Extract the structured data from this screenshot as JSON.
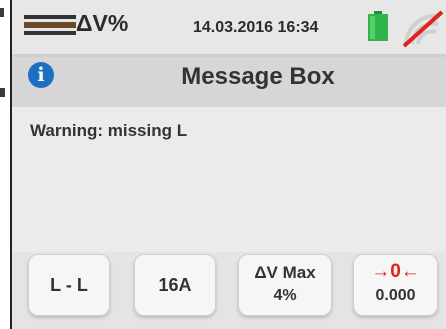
{
  "status_bar": {
    "mode_label": "ΔV%",
    "datetime": "14.03.2016  16:34",
    "battery_icon": "battery-icon",
    "signal_icon": "no-signal-icon"
  },
  "title_bar": {
    "icon": "info-icon",
    "title": "Message Box"
  },
  "message": "Warning: missing L",
  "buttons": [
    {
      "label": "L - L"
    },
    {
      "label": "16A"
    },
    {
      "line1": "ΔV Max",
      "line2": "4%"
    },
    {
      "line1": "→0←",
      "line2": "0.000"
    }
  ],
  "colors": {
    "battery": "#2fb54a",
    "info": "#1d6fc2",
    "zero_arrows": "#e0231e"
  }
}
